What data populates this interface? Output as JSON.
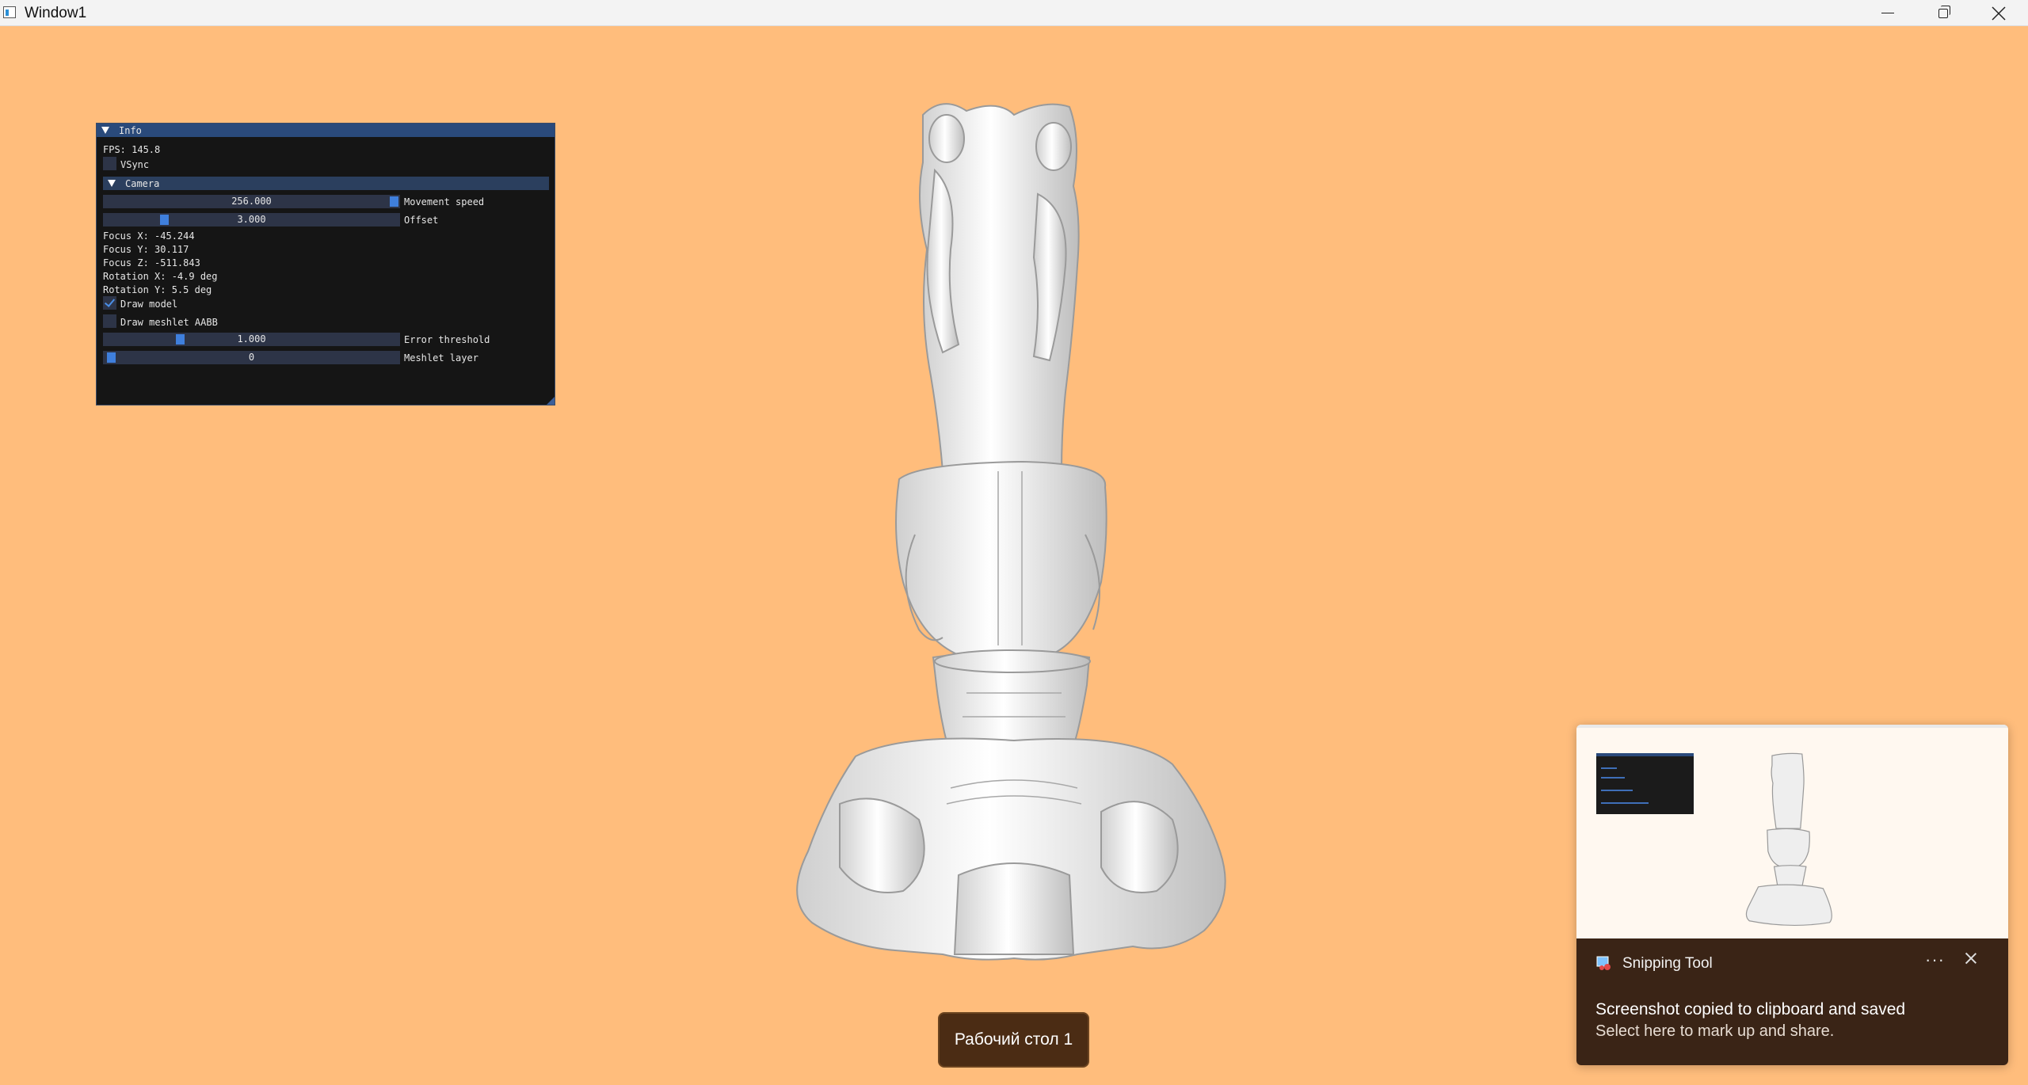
{
  "window": {
    "title": "Window1"
  },
  "panel": {
    "title": "Info",
    "fps": "FPS: 145.8",
    "vsync_label": "VSync",
    "vsync_checked": false,
    "camera": {
      "title": "Camera",
      "movement_speed": {
        "value": "256.000",
        "label": "Movement speed",
        "fraction": 1.0
      },
      "offset": {
        "value": "3.000",
        "label": "Offset",
        "fraction": 0.17
      },
      "focus_x": "Focus X: -45.244",
      "focus_y": "Focus Y: 30.117",
      "focus_z": "Focus Z: -511.843",
      "rotation_x": "Rotation X: -4.9 deg",
      "rotation_y": "Rotation Y: 5.5 deg"
    },
    "draw_model": {
      "label": "Draw model",
      "checked": true
    },
    "draw_meshlet_aabb": {
      "label": "Draw meshlet AABB",
      "checked": false
    },
    "error_threshold": {
      "value": "1.000",
      "label": "Error threshold",
      "fraction": 0.17
    },
    "meshlet_layer": {
      "value": "0",
      "label": "Meshlet layer",
      "fraction": 0.0
    }
  },
  "desktop_indicator": "Рабочий стол 1",
  "toast": {
    "app_name": "Snipping Tool",
    "more_label": "···",
    "message": "Screenshot copied to clipboard and saved",
    "submessage": "Select here to mark up and share."
  },
  "colors": {
    "background": "#ffbd7c",
    "panel_bg": "#151515",
    "panel_header": "#2a4a7b",
    "accent": "#3f7fdc",
    "toast_bg": "#3a2416"
  }
}
